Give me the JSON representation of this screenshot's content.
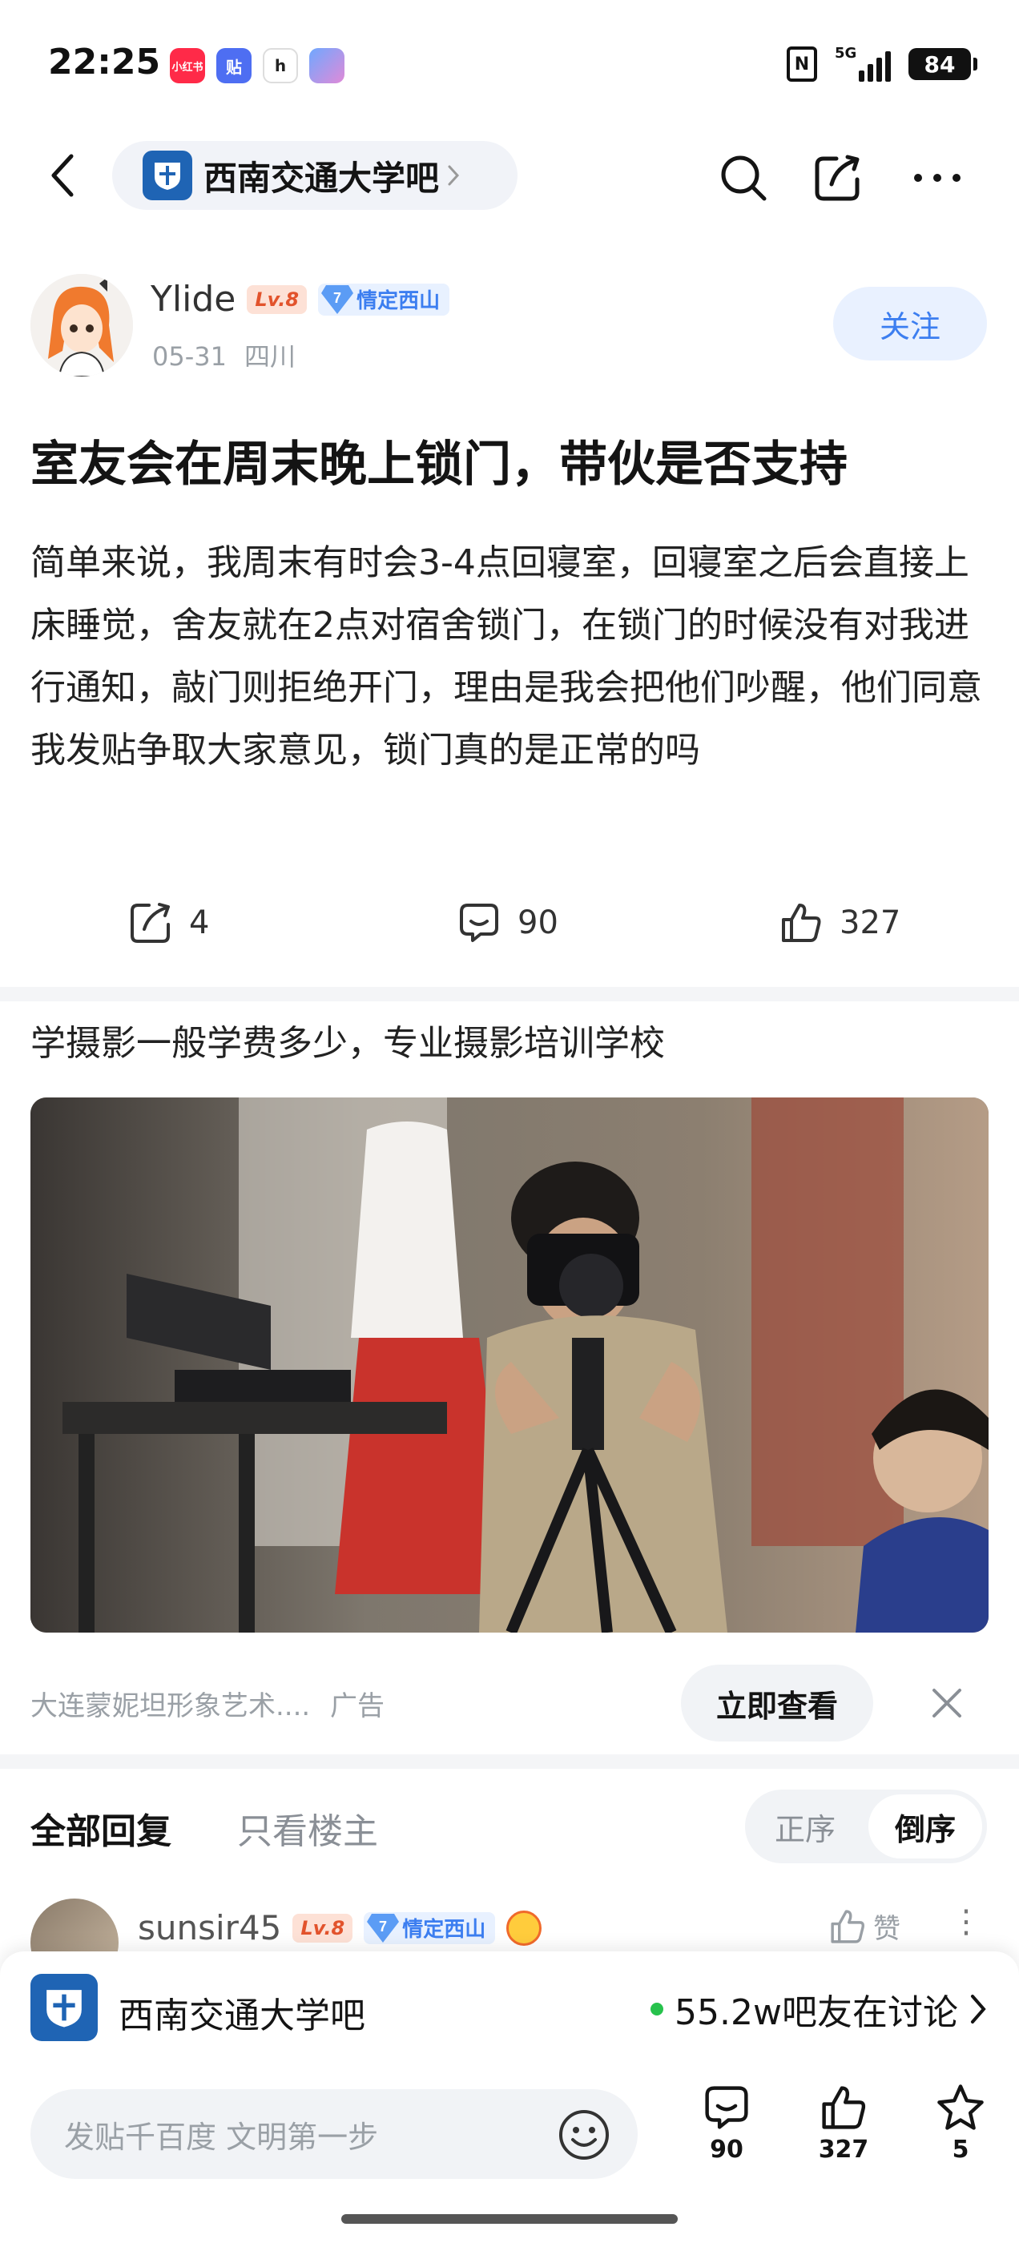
{
  "status_bar": {
    "time": "22:25",
    "notif_icons": [
      "xiaohongshu-icon",
      "tieba-icon",
      "app-icon",
      "game-icon"
    ],
    "notif_labels": [
      "小红书",
      "贴",
      "h"
    ],
    "network": "5G",
    "battery": "84"
  },
  "nav": {
    "forum_name": "西南交通大学吧"
  },
  "author": {
    "name": "Ylide",
    "level": "Lv.8",
    "tag_level": "7",
    "tag": "情定西山",
    "date": "05-31",
    "location": "四川",
    "follow_label": "关注"
  },
  "post": {
    "title": "室友会在周末晚上锁门，带伙是否支持",
    "body": "简单来说，我周末有时会3-4点回寝室，回寝室之后会直接上床睡觉，舍友就在2点对宿舍锁门，在锁门的时候没有对我进行通知，敲门则拒绝开门，理由是我会把他们吵醒，他们同意我发贴争取大家意见，锁门真的是正常的吗",
    "share_count": "4",
    "comment_count": "90",
    "like_count": "327"
  },
  "ad": {
    "title": "学摄影一般学费多少，专业摄影培训学校",
    "source": "大连蒙妮坦形象艺术....",
    "ad_label": "广告",
    "cta": "立即查看"
  },
  "replies": {
    "tab_all": "全部回复",
    "tab_op_only": "只看楼主",
    "sort_asc": "正序",
    "sort_desc": "倒序",
    "first": {
      "name": "sunsir45",
      "level": "Lv.8",
      "tag_level": "7",
      "tag": "情定西山",
      "like_label": "赞"
    }
  },
  "forum_bar": {
    "name": "西南交通大学吧",
    "discussing": "55.2w吧友在讨论"
  },
  "input_bar": {
    "placeholder": "发贴千百度 文明第一步",
    "comment_count": "90",
    "like_count": "327",
    "star_count": "5"
  },
  "colors": {
    "accent": "#3c7ef0",
    "level_badge": "#e2532c",
    "online_dot": "#27c24c"
  }
}
